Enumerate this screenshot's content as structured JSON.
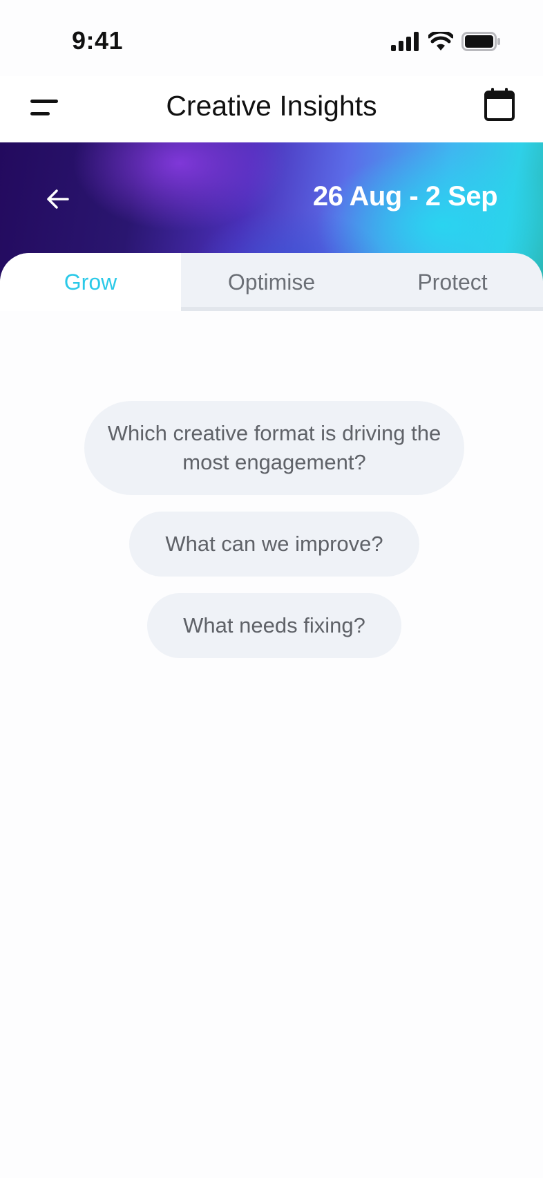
{
  "status_bar": {
    "time": "9:41",
    "icons": [
      "signal-icon",
      "wifi-icon",
      "battery-icon"
    ]
  },
  "header": {
    "title": "Creative Insights",
    "menu_icon": "menu-icon",
    "calendar_icon": "calendar-icon"
  },
  "hero": {
    "back_icon": "arrow-left-icon",
    "date_range": "26 Aug - 2 Sep"
  },
  "tabs": [
    {
      "label": "Grow",
      "active": true
    },
    {
      "label": "Optimise",
      "active": false
    },
    {
      "label": "Protect",
      "active": false
    }
  ],
  "suggestions": [
    "Which creative format is driving the most engagement?",
    "What can we improve?",
    "What needs fixing?"
  ],
  "colors": {
    "accent": "#2bc9e8",
    "chip_background": "#eff2f7",
    "chip_text": "#5f6268",
    "inactive_tab_text": "#6b6f76"
  }
}
